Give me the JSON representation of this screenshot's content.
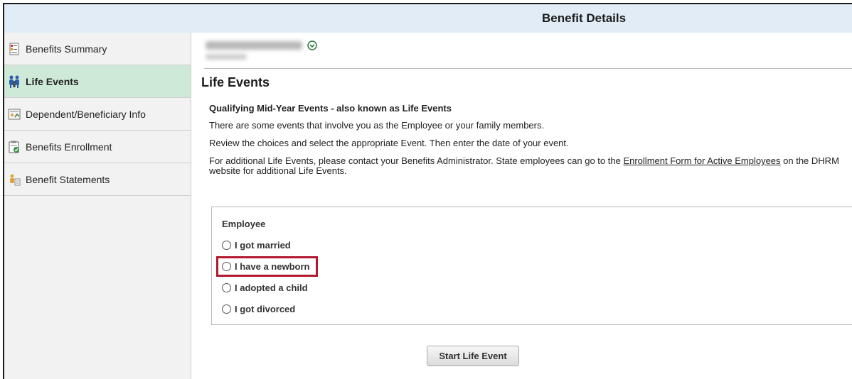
{
  "header": {
    "title": "Benefit Details"
  },
  "sidebar": {
    "items": [
      {
        "label": "Benefits Summary",
        "icon": "benefits-summary-icon",
        "active": false
      },
      {
        "label": "Life Events",
        "icon": "family-icon",
        "active": true
      },
      {
        "label": "Dependent/Beneficiary Info",
        "icon": "dependent-info-icon",
        "active": false
      },
      {
        "label": "Benefits Enrollment",
        "icon": "enrollment-check-icon",
        "active": false
      },
      {
        "label": "Benefit Statements",
        "icon": "statements-icon",
        "active": false
      }
    ]
  },
  "main": {
    "user_chevron_icon": "chevron-down-circle-icon",
    "page_title": "Life Events",
    "intro_heading": "Qualifying Mid-Year Events - also known as Life Events",
    "intro_line1": "There are some events that involve you as the Employee or your family members.",
    "intro_line2": "Review the choices and select the appropriate Event. Then enter the date of your event.",
    "intro_line3_before": "For additional Life Events, please contact your Benefits Administrator. State employees can go to the ",
    "intro_link": "Enrollment Form for Active Employees",
    "intro_line3_after": " on the DHRM website for additional Life Events.",
    "group_label": "Employee",
    "options": [
      "I got married",
      "I have a newborn",
      "I adopted a child",
      "I got divorced"
    ],
    "highlighted_option": "I have a newborn",
    "start_button": "Start Life Event"
  },
  "colors": {
    "header_bg": "#e1ecf6",
    "active_item_bg": "#cfe9d9",
    "highlight_border": "#b3182e"
  }
}
